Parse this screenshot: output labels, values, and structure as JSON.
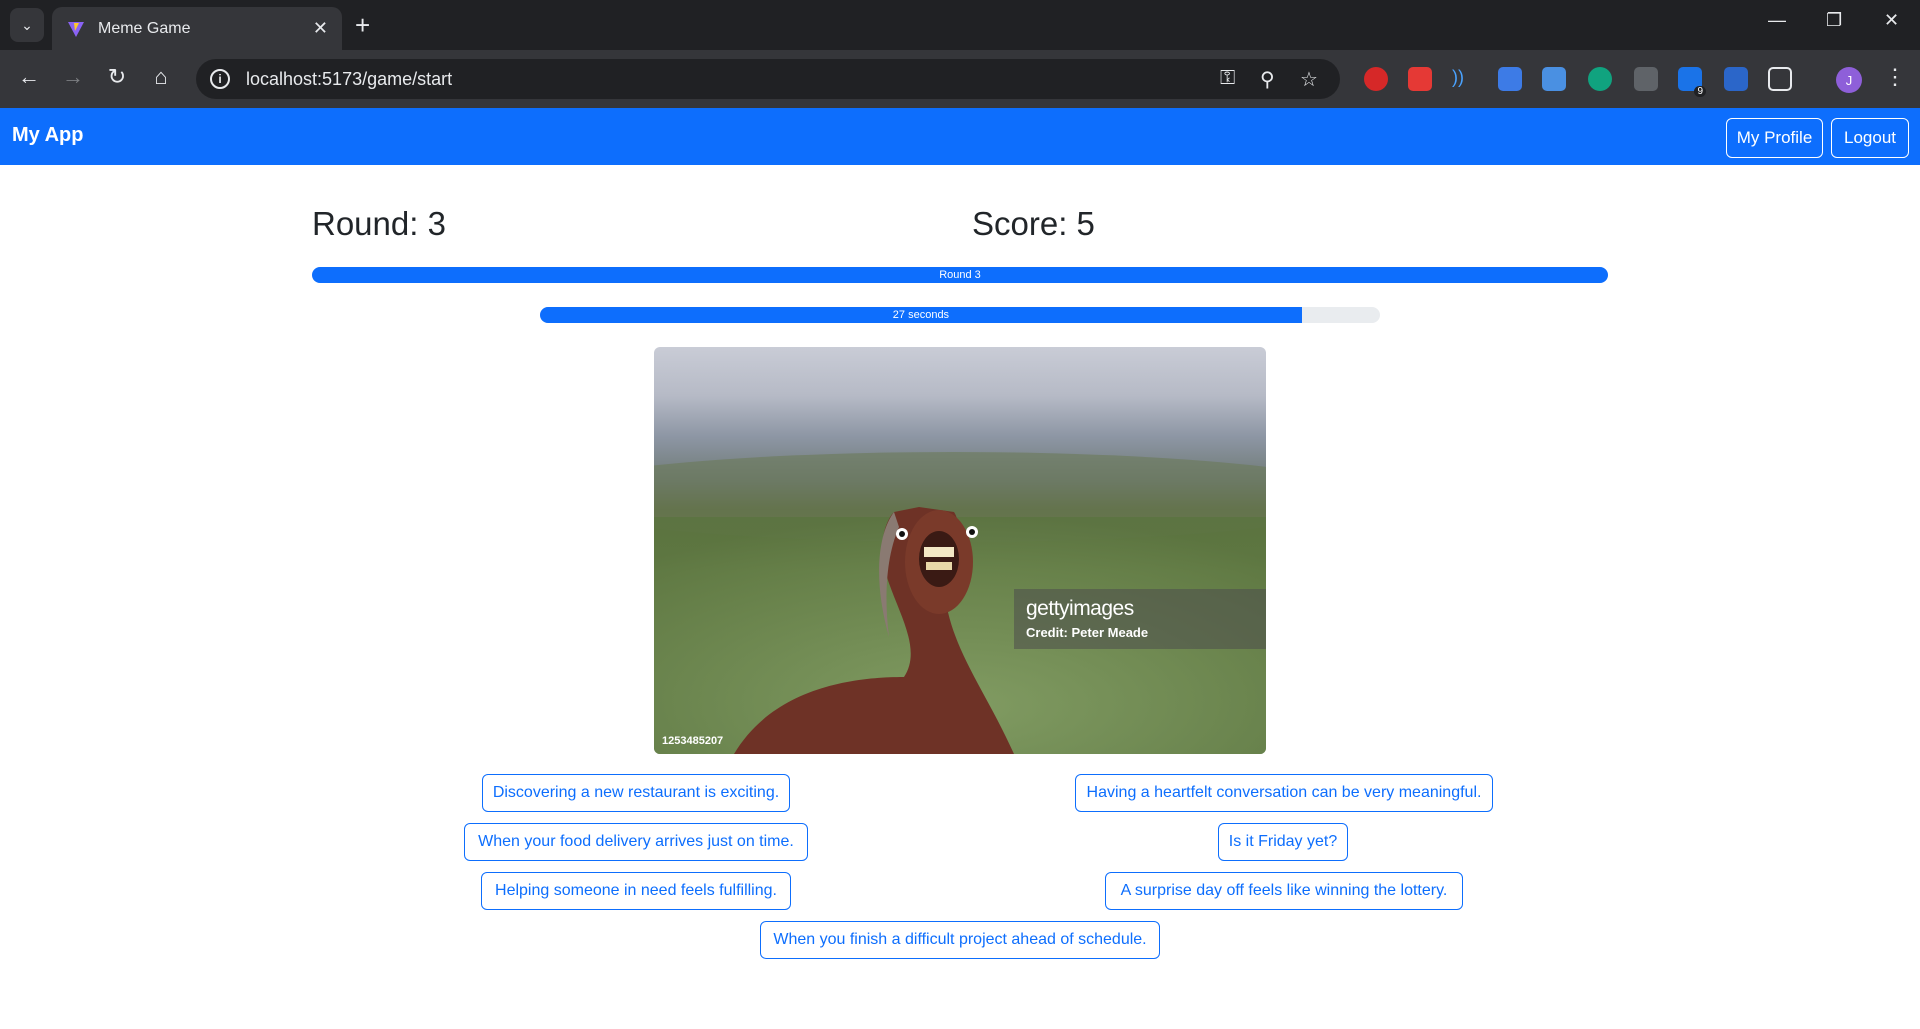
{
  "browser": {
    "tab_title": "Meme Game",
    "url": "localhost:5173/game/start",
    "extension_badge": "9",
    "profile_initial": "J"
  },
  "app": {
    "brand": "My App",
    "profile_button": "My Profile",
    "logout_button": "Logout"
  },
  "game": {
    "round_label": "Round: 3",
    "score_label": "Score: 5",
    "round_progress_label": "Round 3",
    "round_progress_fraction": 1.0,
    "timer_label": "27 seconds",
    "timer_fraction": 0.907
  },
  "meme_image": {
    "watermark_brand": "gettyimages",
    "watermark_credit": "Credit: Peter Meade",
    "image_number": "1253485207"
  },
  "captions": [
    "Discovering a new restaurant is exciting.",
    "Having a heartfelt conversation can be very meaningful.",
    "When your food delivery arrives just on time.",
    "Is it Friday yet?",
    "Helping someone in need feels fulfilling.",
    "A surprise day off feels like winning the lottery.",
    "When you finish a difficult project ahead of schedule."
  ],
  "colors": {
    "primary": "#0d6efd",
    "chrome_dark": "#202124",
    "chrome_toolbar": "#35363a"
  }
}
